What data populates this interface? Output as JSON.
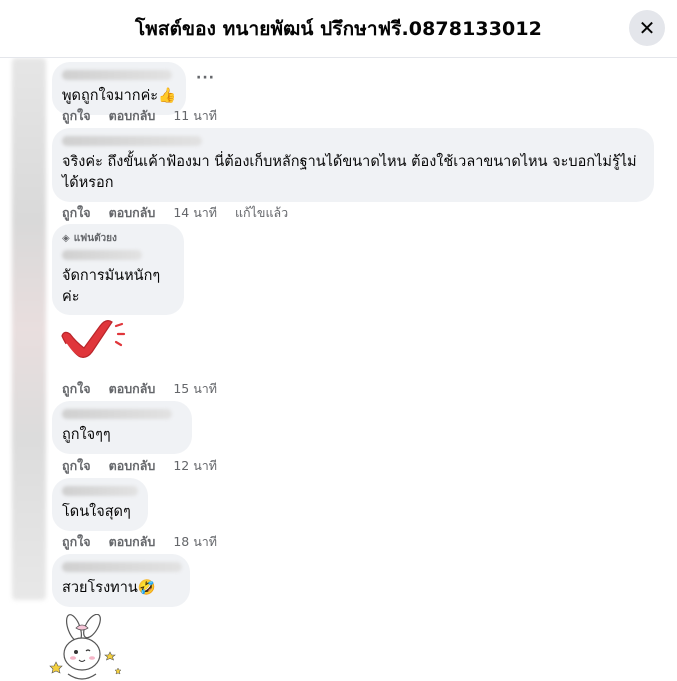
{
  "header": {
    "title": "โพสต์ของ ทนายพัฒน์ ปรึกษาฟรี.0878133012",
    "close_icon": "close-icon"
  },
  "comments": [
    {
      "text": "พูดถูกใจมากค่ะ👍",
      "actions": {
        "like": "ถูกใจ",
        "reply": "ตอบกลับ",
        "time": "11 นาที"
      }
    },
    {
      "text": "จริงค่ะ ถึงขั้นเค้าฟ้องมา นี่ต้องเก็บหลักฐานได้ขนาดไหน ต้องใช้เวลาขนาดไหน จะบอกไม่รู้ไม่ได้หรอก",
      "actions": {
        "like": "ถูกใจ",
        "reply": "ตอบกลับ",
        "time": "14 นาที",
        "edited": "แก้ไขแล้ว"
      }
    },
    {
      "badge": "แฟนตัวยง",
      "text": "จัดการมันหนักๆค่ะ",
      "actions": {
        "like": "ถูกใจ",
        "reply": "ตอบกลับ",
        "time": "15 นาที"
      }
    },
    {
      "text": "ถูกใจๆๆ",
      "actions": {
        "like": "ถูกใจ",
        "reply": "ตอบกลับ",
        "time": "12 นาที"
      }
    },
    {
      "text": "โดนใจสุดๆ",
      "actions": {
        "like": "ถูกใจ",
        "reply": "ตอบกลับ",
        "time": "18 นาที"
      }
    },
    {
      "text": "สวยโรงทาน🤣"
    }
  ],
  "colors": {
    "bubble": "#f0f2f5",
    "meta_text": "#65676b",
    "sticker_red": "#e0363b"
  }
}
